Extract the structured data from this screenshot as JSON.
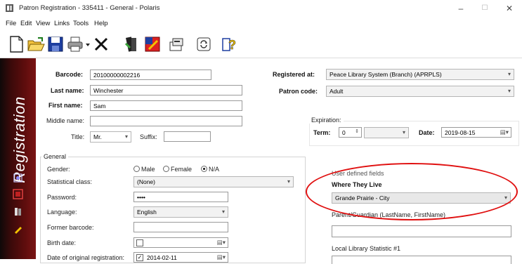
{
  "window": {
    "title": "Patron Registration - 335411 - General - Polaris",
    "minimize": "–",
    "maximize": "☐",
    "close": "✕"
  },
  "menu": [
    "File",
    "Edit",
    "View",
    "Links",
    "Tools",
    "Help"
  ],
  "toolbar_icons": [
    "new-icon",
    "open-folder-icon",
    "save-icon",
    "print-icon",
    "delete-icon",
    "books-icon",
    "edit-icon",
    "properties-icon",
    "refresh-icon",
    "help-icon"
  ],
  "sidebar": {
    "title": "Registration"
  },
  "form": {
    "barcode_label": "Barcode:",
    "barcode_value": "20100000002216",
    "last_name_label": "Last name:",
    "last_name_value": "Winchester",
    "first_name_label": "First name:",
    "first_name_value": "Sam",
    "middle_name_label": "Middle name:",
    "middle_name_value": "",
    "title_label": "Title:",
    "title_value": "Mr.",
    "suffix_label": "Suffix:",
    "suffix_value": "",
    "registered_at_label": "Registered at:",
    "registered_at_value": "Peace Library System (Branch) (APRPLS)",
    "patron_code_label": "Patron code:",
    "patron_code_value": "Adult",
    "expiration_label": "Expiration:",
    "term_label": "Term:",
    "term_value": "0",
    "term_unit_value": "",
    "date_label": "Date:",
    "date_value": "2019-08-15"
  },
  "general": {
    "group_label": "General",
    "gender_label": "Gender:",
    "gender_options": [
      "Male",
      "Female",
      "N/A"
    ],
    "gender_selected": "N/A",
    "stat_class_label": "Statistical class:",
    "stat_class_value": "(None)",
    "password_label": "Password:",
    "password_value": "••••",
    "language_label": "Language:",
    "language_value": "English",
    "former_barcode_label": "Former barcode:",
    "former_barcode_value": "",
    "birth_date_label": "Birth date:",
    "birth_date_value": "",
    "orig_reg_label": "Date of original registration:",
    "orig_reg_value": "2014-02-11"
  },
  "user_defined": {
    "group_label": "User defined fields",
    "where_live_label": "Where They Live",
    "where_live_value": "Grande Prairie - City",
    "parent_label": "Parent/Guardian (LastName, FirstName)",
    "parent_value": "",
    "local_stat_label": "Local Library Statistic #1"
  },
  "colors": {
    "annotation": "#e01010",
    "sidebar": "#5f0d0d"
  }
}
